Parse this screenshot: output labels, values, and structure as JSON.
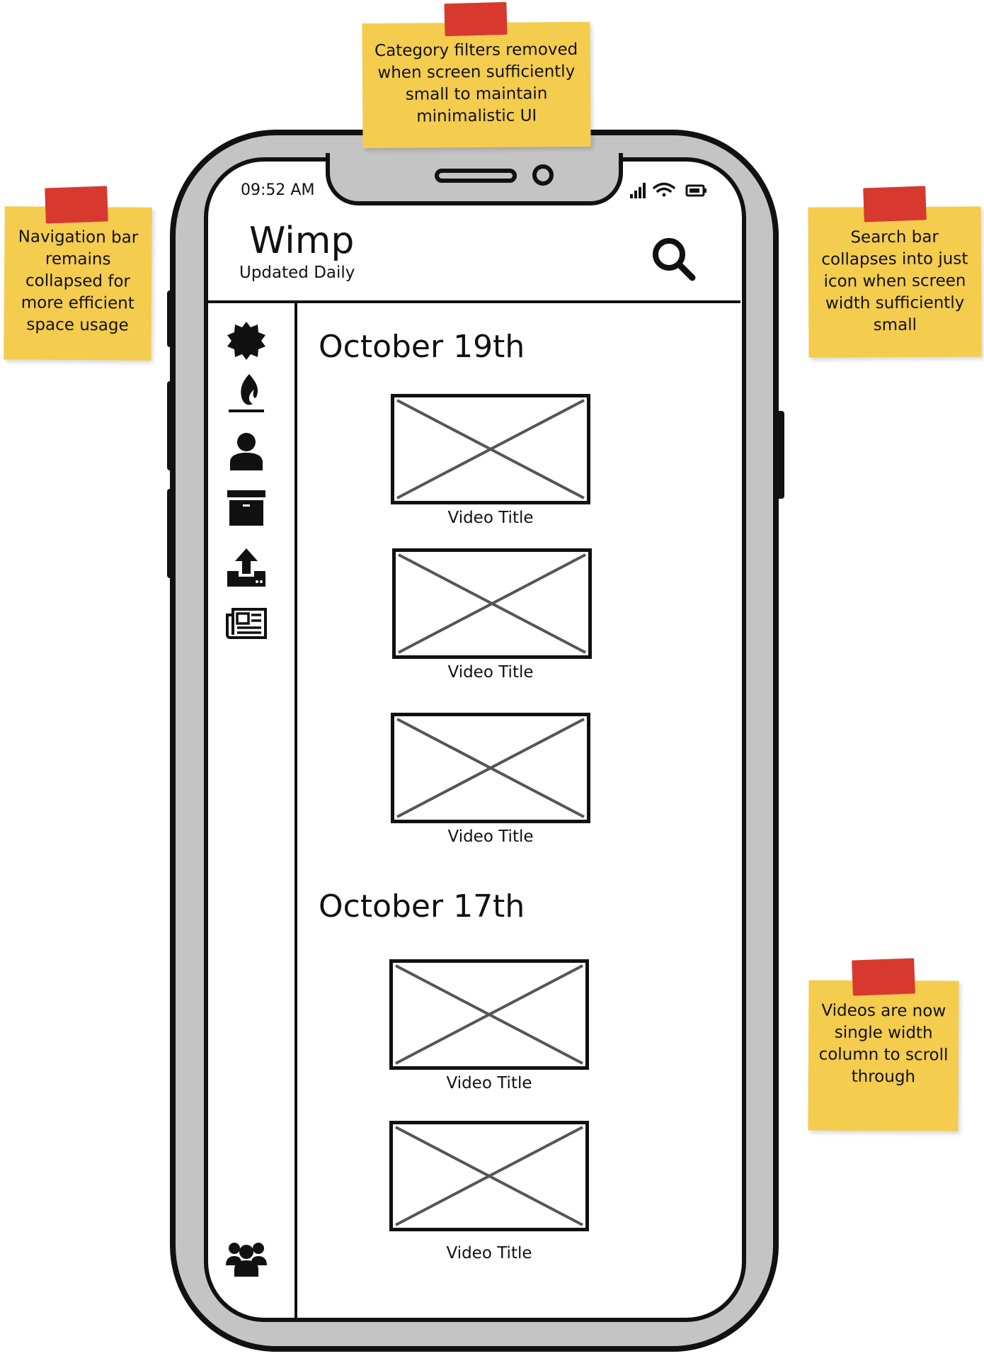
{
  "status_bar": {
    "time": "09:52 AM",
    "icons": [
      "signal-icon",
      "wifi-icon",
      "battery-icon"
    ]
  },
  "header": {
    "title": "Wimp",
    "subtitle": "Updated Daily",
    "search_icon": "search-icon"
  },
  "nav": {
    "items": [
      {
        "icon": "badge-icon"
      },
      {
        "icon": "flame-icon"
      },
      {
        "icon": "user-icon"
      },
      {
        "icon": "archive-box-icon"
      },
      {
        "icon": "upload-icon"
      },
      {
        "icon": "newspaper-icon"
      }
    ],
    "bottom_item": {
      "icon": "users-group-icon"
    }
  },
  "feed": {
    "sections": [
      {
        "date": "October 19th",
        "videos": [
          {
            "title": "Video Title"
          },
          {
            "title": "Video Title"
          },
          {
            "title": "Video Title"
          }
        ]
      },
      {
        "date": "October 17th",
        "videos": [
          {
            "title": "Video Title"
          },
          {
            "title": "Video Title"
          }
        ]
      }
    ]
  },
  "notes": [
    {
      "text": "Category filters removed when screen sufficiently small to maintain minimalistic UI"
    },
    {
      "text": "Navigation bar remains collapsed for more efficient space usage"
    },
    {
      "text": "Search bar collapses into just icon when screen width sufficiently small"
    },
    {
      "text": "Videos are now single width column to scroll through"
    }
  ],
  "colors": {
    "note": "#f4cc4e",
    "tape": "#d8392f",
    "phone_frame": "#c4c4c4",
    "placeholder_x": "#555555"
  }
}
